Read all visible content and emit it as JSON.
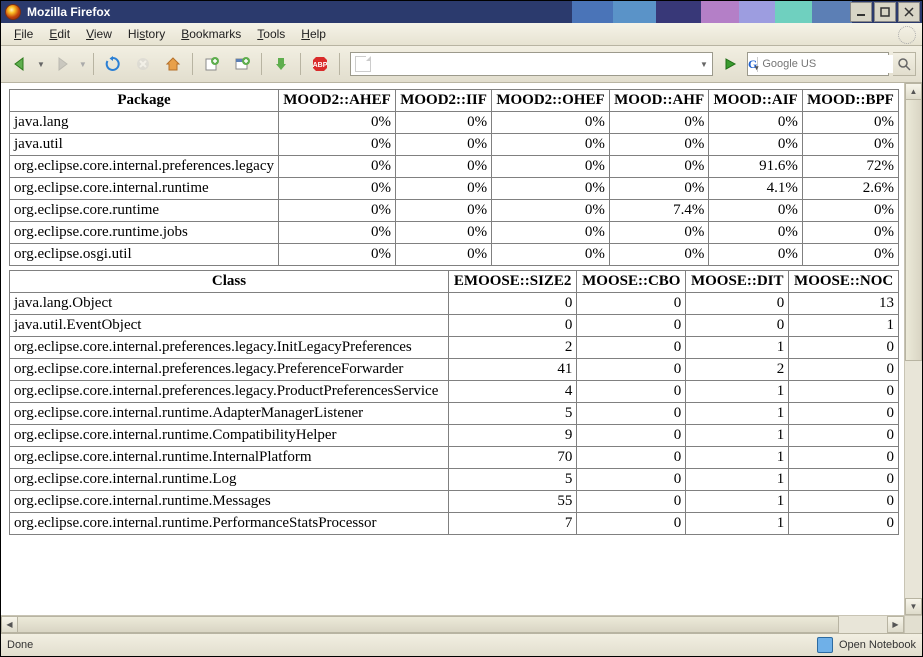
{
  "titlebar": {
    "title": "Mozilla Firefox"
  },
  "menu": {
    "file": "File",
    "edit": "Edit",
    "view": "View",
    "history": "History",
    "bookmarks": "Bookmarks",
    "tools": "Tools",
    "help": "Help"
  },
  "toolbar": {
    "url": "",
    "search_engine": "G",
    "search_placeholder": "Google US"
  },
  "stripe_colors": [
    "#4a74b8",
    "#5a93c8",
    "#383878",
    "#b47fc7",
    "#9d9de0",
    "#6fd0bf",
    "#5c7fb5"
  ],
  "table_package": {
    "headers": [
      "Package",
      "MOOD2::AHEF",
      "MOOD2::IIF",
      "MOOD2::OHEF",
      "MOOD::AHF",
      "MOOD::AIF",
      "MOOD::BPF"
    ],
    "rows": [
      [
        "java.lang",
        "0%",
        "0%",
        "0%",
        "0%",
        "0%",
        "0%"
      ],
      [
        "java.util",
        "0%",
        "0%",
        "0%",
        "0%",
        "0%",
        "0%"
      ],
      [
        "org.eclipse.core.internal.preferences.legacy",
        "0%",
        "0%",
        "0%",
        "0%",
        "91.6%",
        "72%"
      ],
      [
        "org.eclipse.core.internal.runtime",
        "0%",
        "0%",
        "0%",
        "0%",
        "4.1%",
        "2.6%"
      ],
      [
        "org.eclipse.core.runtime",
        "0%",
        "0%",
        "0%",
        "7.4%",
        "0%",
        "0%"
      ],
      [
        "org.eclipse.core.runtime.jobs",
        "0%",
        "0%",
        "0%",
        "0%",
        "0%",
        "0%"
      ],
      [
        "org.eclipse.osgi.util",
        "0%",
        "0%",
        "0%",
        "0%",
        "0%",
        "0%"
      ]
    ]
  },
  "table_class": {
    "headers": [
      "Class",
      "EMOOSE::SIZE2",
      "MOOSE::CBO",
      "MOOSE::DIT",
      "MOOSE::NOC"
    ],
    "rows": [
      [
        "java.lang.Object",
        "0",
        "0",
        "0",
        "13"
      ],
      [
        "java.util.EventObject",
        "0",
        "0",
        "0",
        "1"
      ],
      [
        "org.eclipse.core.internal.preferences.legacy.InitLegacyPreferences",
        "2",
        "0",
        "1",
        "0"
      ],
      [
        "org.eclipse.core.internal.preferences.legacy.PreferenceForwarder",
        "41",
        "0",
        "2",
        "0"
      ],
      [
        "org.eclipse.core.internal.preferences.legacy.ProductPreferencesService",
        "4",
        "0",
        "1",
        "0"
      ],
      [
        "org.eclipse.core.internal.runtime.AdapterManagerListener",
        "5",
        "0",
        "1",
        "0"
      ],
      [
        "org.eclipse.core.internal.runtime.CompatibilityHelper",
        "9",
        "0",
        "1",
        "0"
      ],
      [
        "org.eclipse.core.internal.runtime.InternalPlatform",
        "70",
        "0",
        "1",
        "0"
      ],
      [
        "org.eclipse.core.internal.runtime.Log",
        "5",
        "0",
        "1",
        "0"
      ],
      [
        "org.eclipse.core.internal.runtime.Messages",
        "55",
        "0",
        "1",
        "0"
      ],
      [
        "org.eclipse.core.internal.runtime.PerformanceStatsProcessor",
        "7",
        "0",
        "1",
        "0"
      ]
    ]
  },
  "status": {
    "left": "Done",
    "right": "Open Notebook"
  }
}
